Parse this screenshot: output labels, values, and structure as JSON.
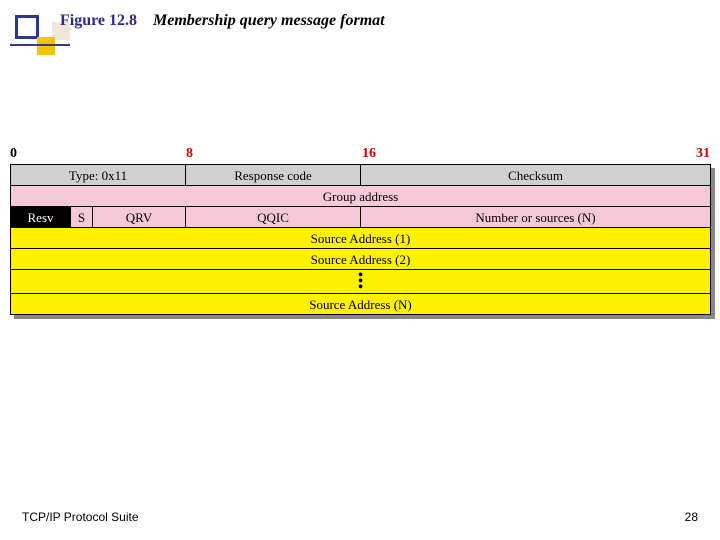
{
  "figure": {
    "num": "Figure 12.8",
    "caption": "Membership query message format"
  },
  "bits": {
    "b0": "0",
    "b8": "8",
    "b16": "16",
    "b31": "31"
  },
  "fields": {
    "type": "Type: 0x11",
    "resp": "Response code",
    "checksum": "Checksum",
    "group": "Group address",
    "resv": "Resv",
    "s": "S",
    "qrv": "QRV",
    "qqic": "QQIC",
    "nsrc": "Number or sources (N)",
    "src1": "Source Address (1)",
    "src2": "Source Address (2)",
    "srcN": "Source Address (N)"
  },
  "footer": "TCP/IP Protocol Suite",
  "page": "28"
}
